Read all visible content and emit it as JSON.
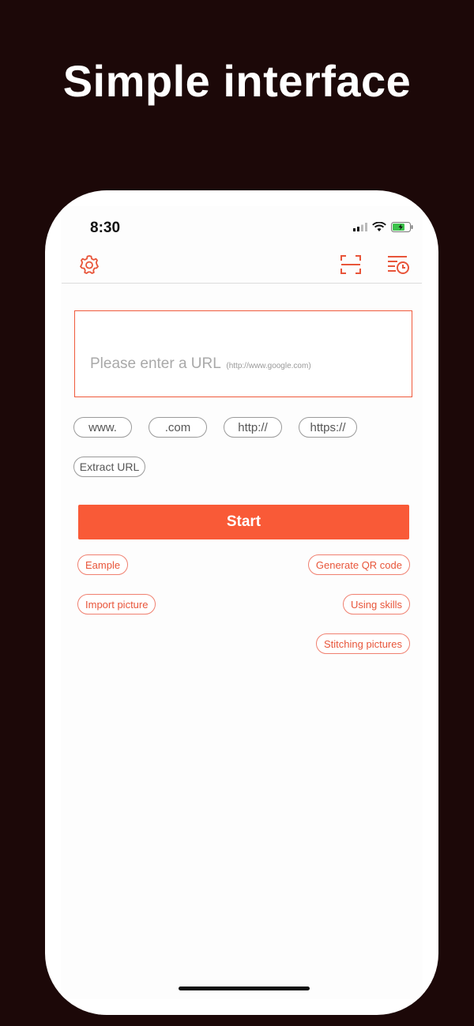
{
  "headline": "Simple interface",
  "status_bar": {
    "time": "8:30"
  },
  "toolbar": {
    "settings_icon": "gear-icon",
    "scan_icon": "scan-icon",
    "history_icon": "history-icon"
  },
  "url_input": {
    "placeholder": "Please enter a URL",
    "hint": "(http://www.google.com)"
  },
  "quick_chips": [
    "www.",
    ".com",
    "http://",
    "https://"
  ],
  "extract_label": "Extract URL",
  "start_label": "Start",
  "actions": {
    "example": "Eample",
    "generate_qr": "Generate QR code",
    "import_picture": "Import picture",
    "using_skills": "Using skills",
    "stitching": "Stitching pictures"
  },
  "colors": {
    "accent": "#f95a37",
    "background": "#1c0808"
  }
}
